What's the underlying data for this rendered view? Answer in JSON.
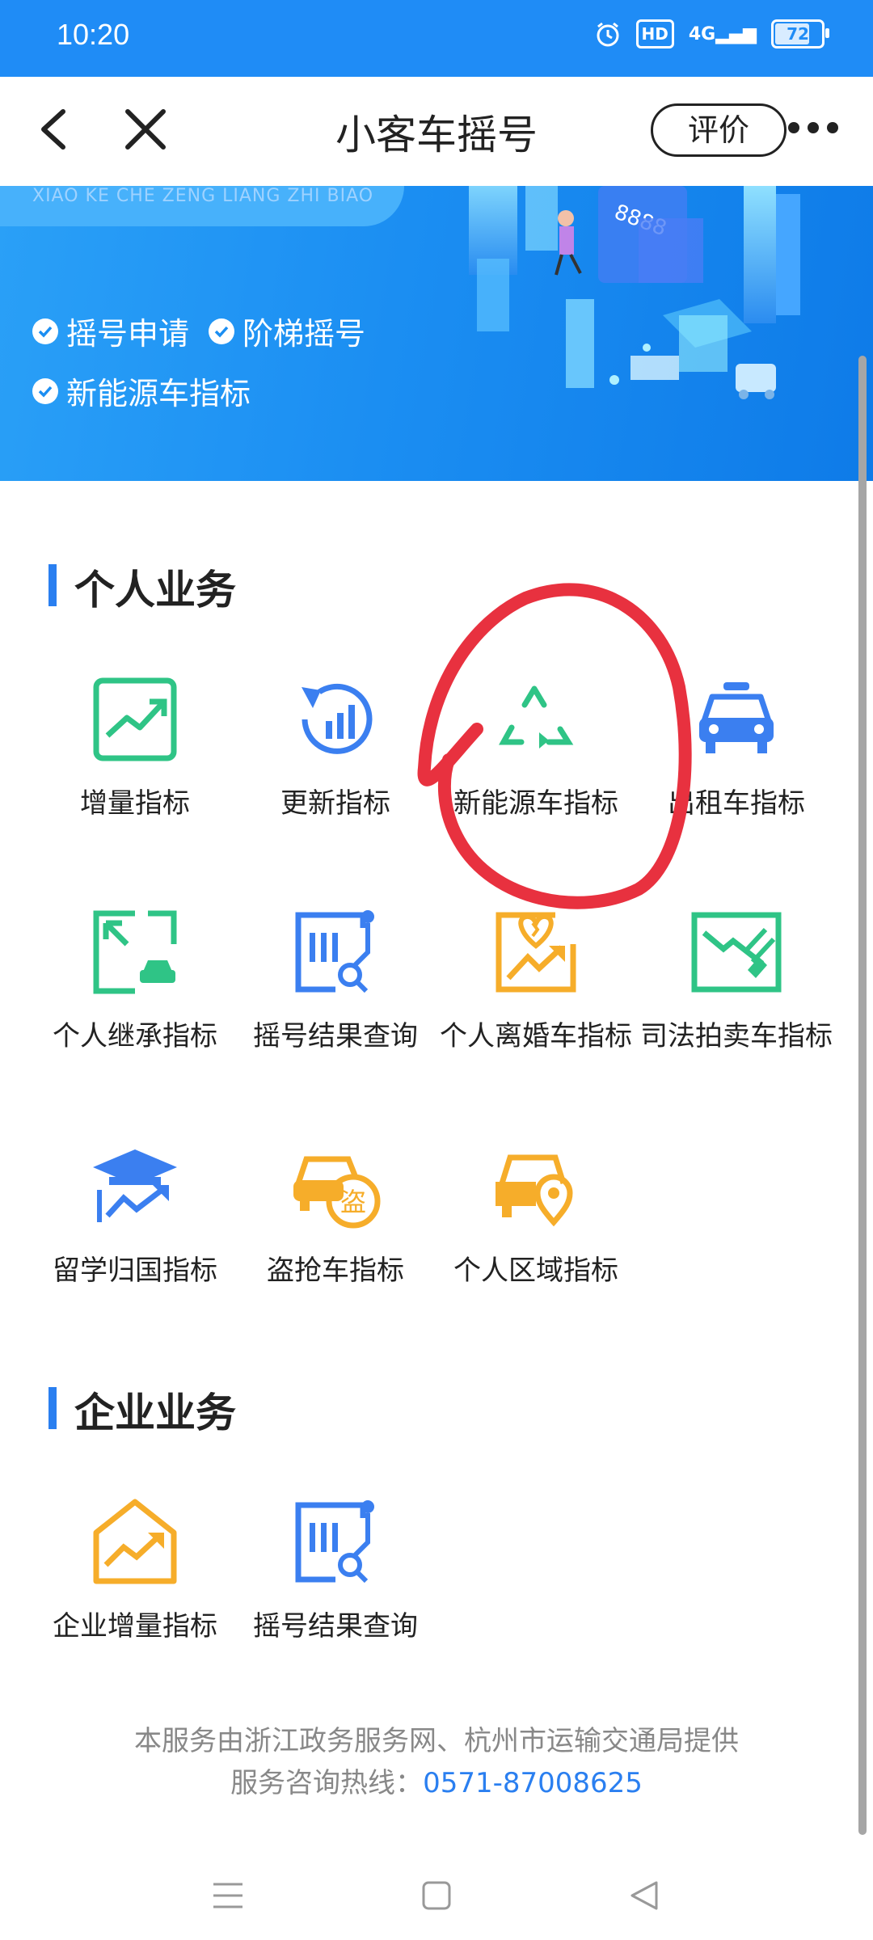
{
  "status_bar": {
    "time": "10:20",
    "hd": "HD",
    "signal": "4G",
    "battery": "72"
  },
  "title_bar": {
    "title": "小客车摇号",
    "rate_label": "评价"
  },
  "banner": {
    "pinyin": "XIAO KE CHE ZENG LIANG ZHI BIAO",
    "features": [
      "摇号申请",
      "阶梯摇号",
      "新能源车指标"
    ],
    "plate_text": "8888"
  },
  "personal": {
    "title": "个人业务",
    "items": [
      {
        "label": "增量指标",
        "icon": "trend-chart-icon",
        "color": "#2fc486"
      },
      {
        "label": "更新指标",
        "icon": "refresh-chart-icon",
        "color": "#3b7ff0"
      },
      {
        "label": "新能源车指标",
        "icon": "recycle-icon",
        "color": "#2fc486"
      },
      {
        "label": "出租车指标",
        "icon": "taxi-icon",
        "color": "#3b7ff0"
      },
      {
        "label": "个人继承指标",
        "icon": "inherit-car-icon",
        "color": "#2fc486"
      },
      {
        "label": "摇号结果查询",
        "icon": "result-search-icon",
        "color": "#3b7ff0"
      },
      {
        "label": "个人离婚车指标",
        "icon": "divorce-heart-icon",
        "color": "#f6ad2a"
      },
      {
        "label": "司法拍卖车指标",
        "icon": "auction-hammer-icon",
        "color": "#2fc486"
      },
      {
        "label": "留学归国指标",
        "icon": "graduation-cap-icon",
        "color": "#3b7ff0"
      },
      {
        "label": "盗抢车指标",
        "icon": "stolen-car-icon",
        "color": "#f6ad2a"
      },
      {
        "label": "个人区域指标",
        "icon": "car-location-icon",
        "color": "#f6ad2a"
      }
    ]
  },
  "enterprise": {
    "title": "企业业务",
    "items": [
      {
        "label": "企业增量指标",
        "icon": "house-trend-icon",
        "color": "#f6ad2a"
      },
      {
        "label": "摇号结果查询",
        "icon": "result-search-icon",
        "color": "#3b7ff0"
      }
    ]
  },
  "footer": {
    "provider": "本服务由浙江政务服务网、杭州市运输交通局提供",
    "hotline_label": "服务咨询热线：",
    "hotline_number": "0571-87008625"
  },
  "annotation": {
    "color": "#e8313f",
    "shape": "hand-drawn circle around 新能源车指标"
  }
}
